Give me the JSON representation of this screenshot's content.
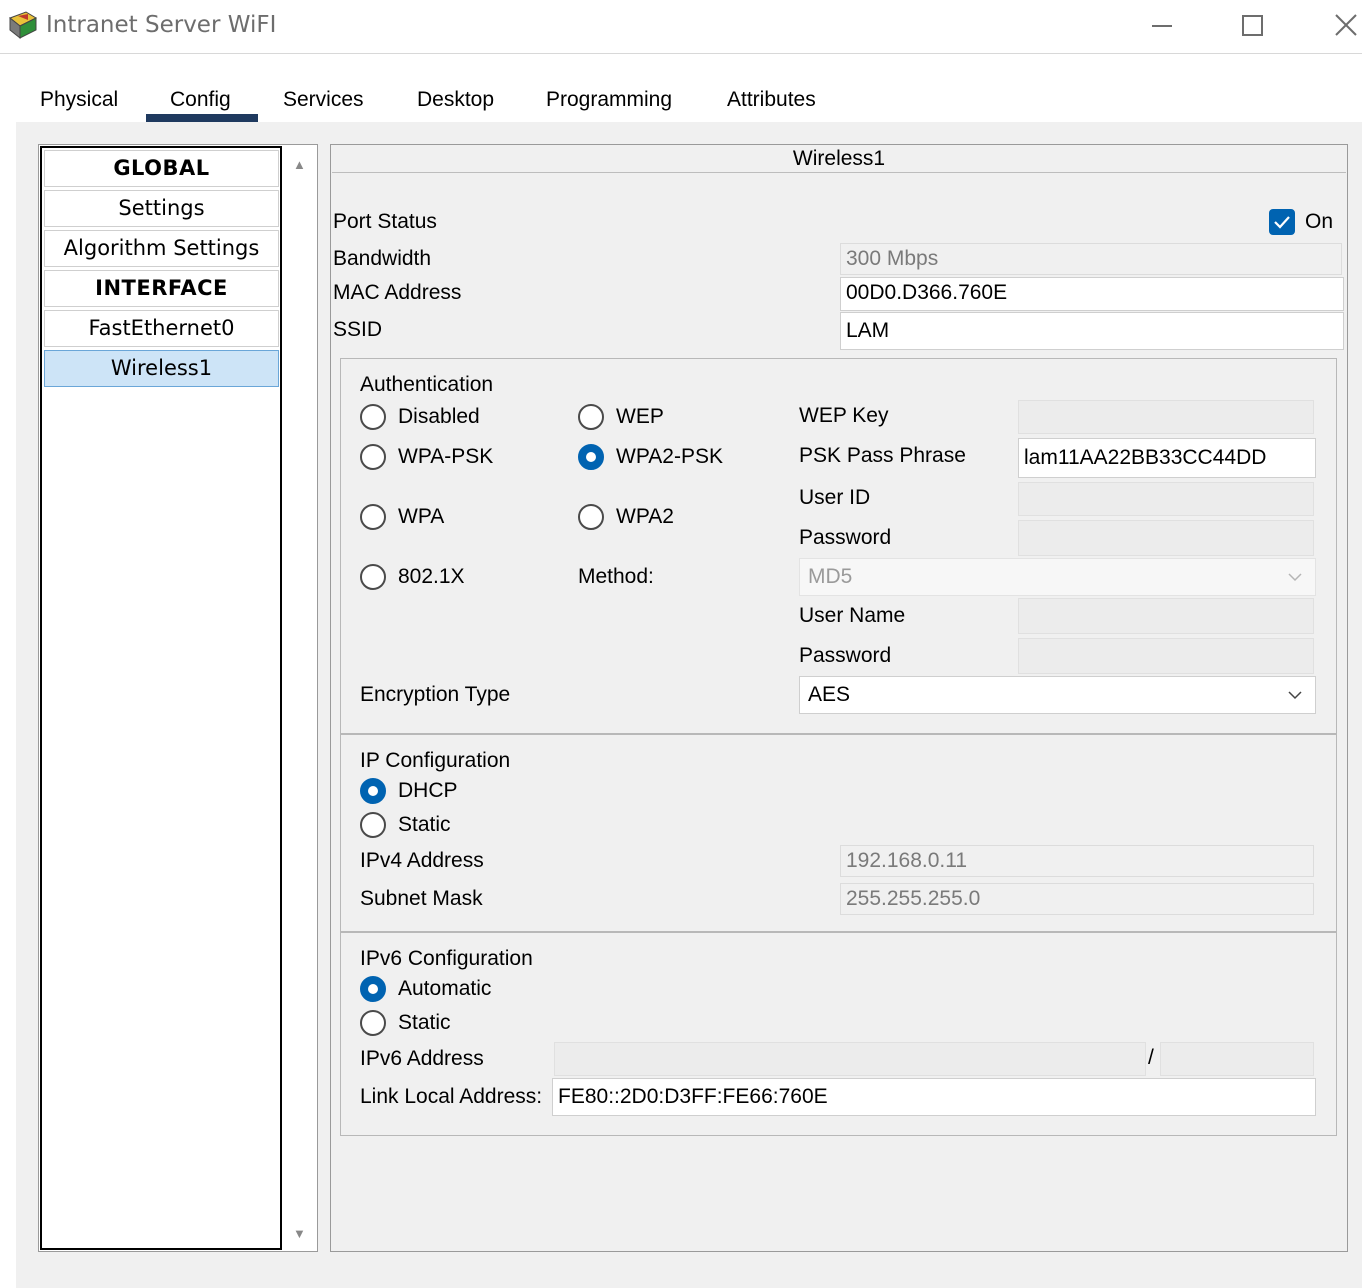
{
  "window": {
    "title": "Intranet Server WiFI",
    "icon": "packet-tracer-server-icon",
    "controls": [
      "minimize-icon",
      "maximize-icon",
      "close-icon"
    ]
  },
  "tabs": [
    {
      "label": "Physical",
      "active": false
    },
    {
      "label": "Config",
      "active": true
    },
    {
      "label": "Services",
      "active": false
    },
    {
      "label": "Desktop",
      "active": false
    },
    {
      "label": "Programming",
      "active": false
    },
    {
      "label": "Attributes",
      "active": false
    }
  ],
  "nav": {
    "items": [
      {
        "label": "GLOBAL",
        "type": "header"
      },
      {
        "label": "Settings",
        "type": "item"
      },
      {
        "label": "Algorithm Settings",
        "type": "item"
      },
      {
        "label": "INTERFACE",
        "type": "header"
      },
      {
        "label": "FastEthernet0",
        "type": "item"
      },
      {
        "label": "Wireless1",
        "type": "item",
        "selected": true
      }
    ]
  },
  "panel": {
    "title": "Wireless1",
    "port_status": {
      "label": "Port Status",
      "checkbox_label": "On",
      "checked": true
    },
    "bandwidth": {
      "label": "Bandwidth",
      "value": "300 Mbps"
    },
    "mac": {
      "label": "MAC Address",
      "value": "00D0.D366.760E"
    },
    "ssid": {
      "label": "SSID",
      "value": "LAM"
    },
    "auth": {
      "title": "Authentication",
      "options": {
        "disabled": "Disabled",
        "wep": "WEP",
        "wpa_psk": "WPA-PSK",
        "wpa2_psk": "WPA2-PSK",
        "wpa": "WPA",
        "wpa2": "WPA2",
        "dot1x": "802.1X"
      },
      "selected": "WPA2-PSK",
      "wep_key_label": "WEP Key",
      "wep_key_value": "",
      "psk_label": "PSK Pass Phrase",
      "psk_value": "lam11AA22BB33CC44DD",
      "user_id_label": "User ID",
      "password_label": "Password",
      "method_label": "Method:",
      "method_value": "MD5",
      "user_name_label": "User Name",
      "password2_label": "Password",
      "encryption_label": "Encryption Type",
      "encryption_value": "AES"
    },
    "ip": {
      "title": "IP Configuration",
      "dhcp": "DHCP",
      "static": "Static",
      "selected": "DHCP",
      "ipv4_label": "IPv4 Address",
      "ipv4_value": "192.168.0.11",
      "mask_label": "Subnet Mask",
      "mask_value": "255.255.255.0"
    },
    "ipv6": {
      "title": "IPv6 Configuration",
      "automatic": "Automatic",
      "static": "Static",
      "selected": "Automatic",
      "address_label": "IPv6 Address",
      "address_value": "",
      "prefix_sep": "/",
      "prefix_value": "",
      "link_local_label": "Link Local Address:",
      "link_local_value": "FE80::2D0:D3FF:FE66:760E"
    }
  },
  "colors": {
    "accent": "#0063b1",
    "selected_nav": "#cde4f7",
    "tab_underline": "#1f3a5f"
  }
}
